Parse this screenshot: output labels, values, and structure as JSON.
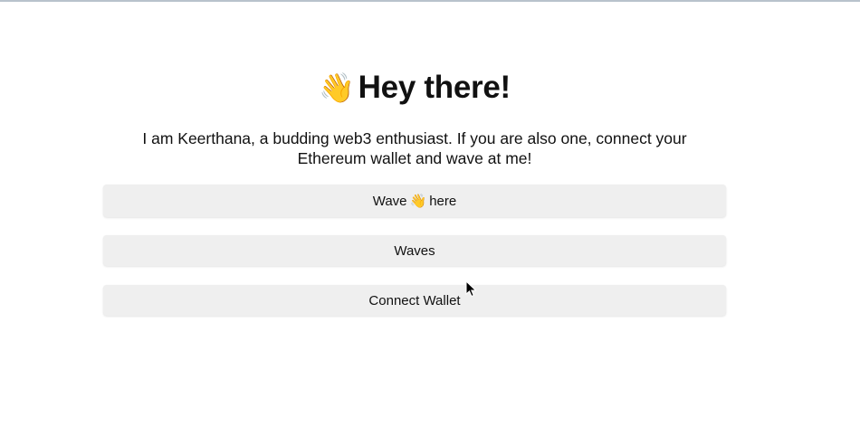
{
  "header": {
    "emoji": "👋",
    "title": "Hey there!"
  },
  "bio": {
    "text": "I am Keerthana, a budding web3 enthusiast. If you are also one, connect your Ethereum wallet and wave at me!"
  },
  "buttons": {
    "wave": {
      "label_before": "Wave",
      "emoji": "👋",
      "label_after": "here"
    },
    "waves": {
      "label": "Waves"
    },
    "connect_wallet": {
      "label": "Connect Wallet"
    }
  },
  "icons": {
    "cursor": "mouse-pointer-icon"
  }
}
